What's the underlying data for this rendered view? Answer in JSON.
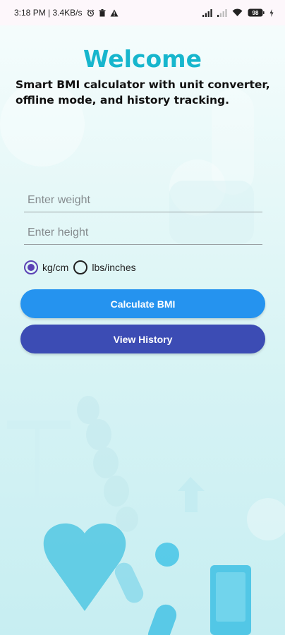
{
  "status_bar": {
    "time_info": "3:18 PM | 3.4KB/s",
    "battery": "98"
  },
  "header": {
    "title": "Welcome",
    "subtitle": "Smart BMI calculator with unit converter, offline mode, and history tracking."
  },
  "form": {
    "weight_placeholder": "Enter weight",
    "height_placeholder": "Enter height",
    "units": [
      {
        "label": "kg/cm",
        "selected": true
      },
      {
        "label": "lbs/inches",
        "selected": false
      }
    ]
  },
  "actions": {
    "calculate_label": "Calculate BMI",
    "history_label": "View History"
  },
  "colors": {
    "title": "#17b6cd",
    "calculate_button": "#2593ef",
    "history_button": "#3c4cb4",
    "radio_selected": "#5b41b5"
  }
}
